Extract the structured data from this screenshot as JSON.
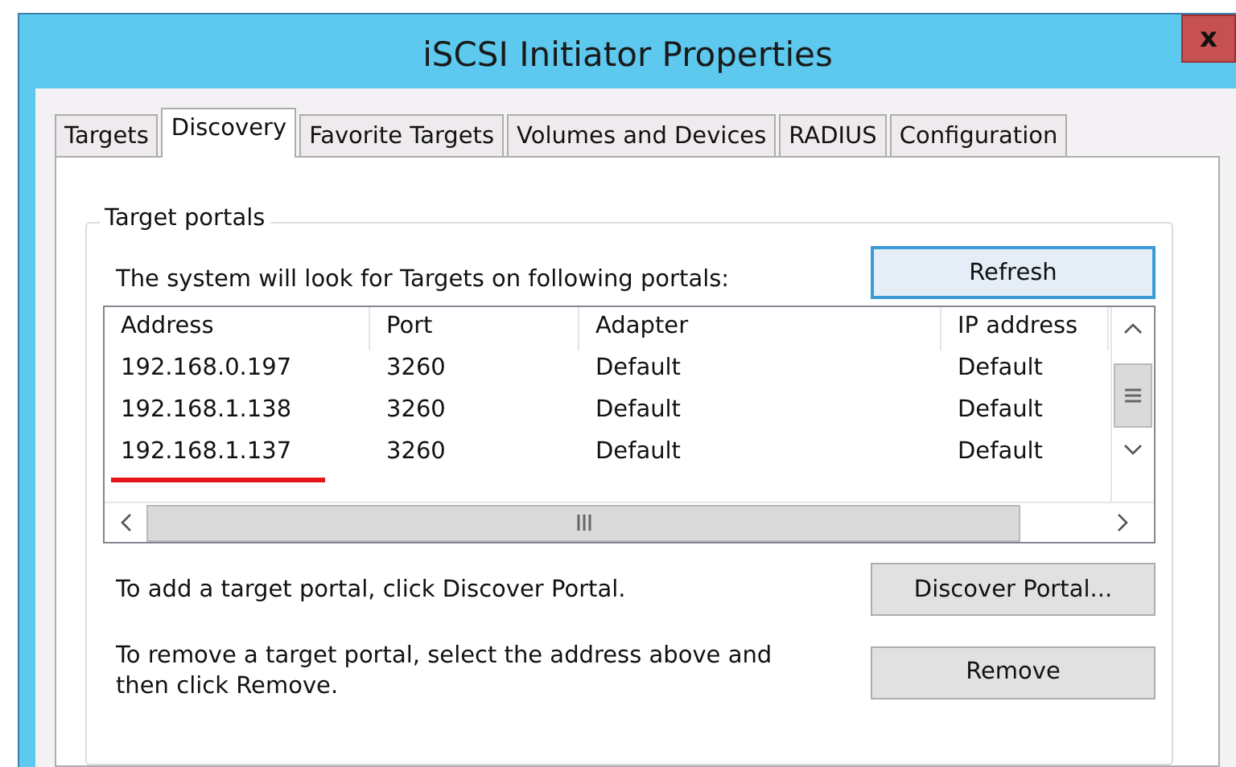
{
  "window": {
    "title": "iSCSI Initiator Properties",
    "close": "x"
  },
  "tabs": [
    {
      "label": "Targets",
      "selected": false
    },
    {
      "label": "Discovery",
      "selected": true
    },
    {
      "label": "Favorite Targets",
      "selected": false
    },
    {
      "label": "Volumes and Devices",
      "selected": false
    },
    {
      "label": "RADIUS",
      "selected": false
    },
    {
      "label": "Configuration",
      "selected": false
    }
  ],
  "group": {
    "title": "Target portals",
    "intro": "The system will look for Targets on following portals:",
    "refresh": "Refresh",
    "columns": [
      "Address",
      "Port",
      "Adapter",
      "IP address"
    ],
    "rows": [
      {
        "cells": [
          "192.168.0.197",
          "3260",
          "Default",
          "Default"
        ],
        "underlined": false
      },
      {
        "cells": [
          "192.168.1.138",
          "3260",
          "Default",
          "Default"
        ],
        "underlined": false
      },
      {
        "cells": [
          "192.168.1.137",
          "3260",
          "Default",
          "Default"
        ],
        "underlined": true
      }
    ],
    "add_text": "To add a target portal, click Discover Portal.",
    "discover": "Discover Portal...",
    "remove_text": "To remove a target portal, select the address above and then click Remove.",
    "remove": "Remove"
  }
}
